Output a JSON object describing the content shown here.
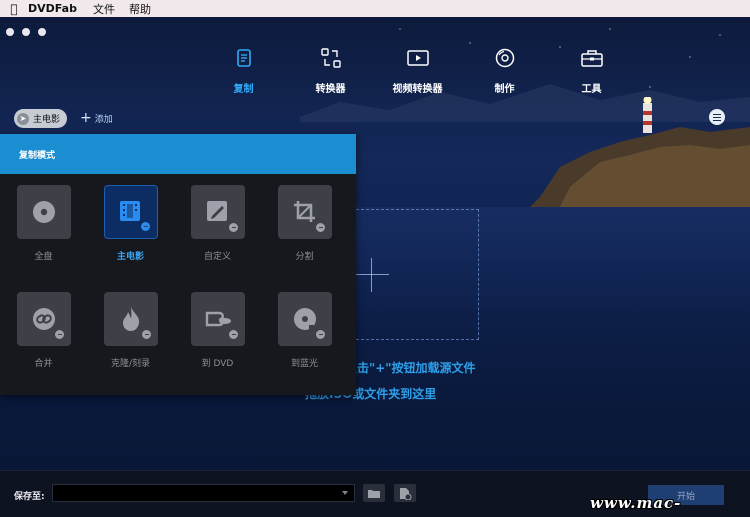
{
  "menubar": {
    "app_name": "DVDFab",
    "items": [
      "文件",
      "帮助"
    ]
  },
  "nav": {
    "items": [
      {
        "label": "复制",
        "icon": "copy-icon",
        "active": true
      },
      {
        "label": "转换器",
        "icon": "converter-icon"
      },
      {
        "label": "视频转换器",
        "icon": "video-converter-icon"
      },
      {
        "label": "制作",
        "icon": "disc-creator-icon"
      },
      {
        "label": "工具",
        "icon": "toolbox-icon"
      }
    ]
  },
  "mode_pill": {
    "label": "主电影"
  },
  "add": {
    "label": "添加"
  },
  "popup": {
    "title": "复制模式",
    "tiles": [
      {
        "label": "全盘",
        "icon": "full-disc-icon"
      },
      {
        "label": "主电影",
        "icon": "main-movie-icon",
        "active": true
      },
      {
        "label": "自定义",
        "icon": "customize-icon"
      },
      {
        "label": "分割",
        "icon": "split-icon"
      },
      {
        "label": "合并",
        "icon": "merge-icon"
      },
      {
        "label": "克隆/刻录",
        "icon": "clone-burn-icon"
      },
      {
        "label": "到 DVD",
        "icon": "to-dvd-icon"
      },
      {
        "label": "到蓝光",
        "icon": "to-bluray-icon"
      }
    ]
  },
  "drop_hint": {
    "line1": "点击\"+\"按钮加载源文件",
    "line2": "拖放ISO或文件夹到这里"
  },
  "bottom": {
    "save_label": "保存至:",
    "save_value": "",
    "start_label": "开始"
  },
  "watermark": "www.mac-gm.com",
  "colors": {
    "accent": "#1a8ed0",
    "active_text": "#33a9f5"
  }
}
